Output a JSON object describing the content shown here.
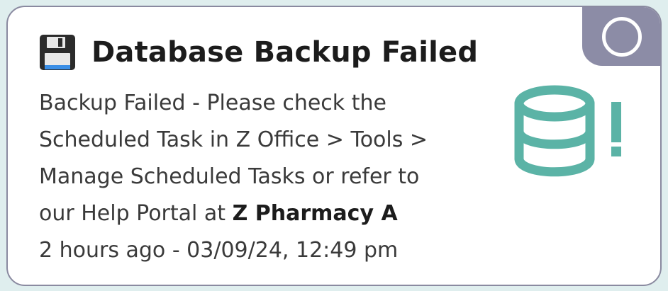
{
  "notification": {
    "title": "Database Backup Failed",
    "title_icon": "floppy-disk-icon",
    "message_lines": [
      "Backup Failed - Please check the",
      "Scheduled Task in Z Office > Tools >",
      "Manage Scheduled Tasks or refer to"
    ],
    "message_last_prefix": "our Help Portal at ",
    "message_last_bold": "Z Pharmacy A",
    "timestamp": "2 hours ago - 03/09/24, 12:49 pm",
    "status_icon": "database-alert-icon",
    "corner_icon": "circle-icon"
  },
  "colors": {
    "card_border": "#8a8aa0",
    "corner_badge": "#8c8ca6",
    "database_icon": "#5bb3a6",
    "floppy_body": "#2b2b2b",
    "floppy_label": "#3a8ee6",
    "title_text": "#1c1c1c",
    "body_text": "#3a3a3a"
  }
}
